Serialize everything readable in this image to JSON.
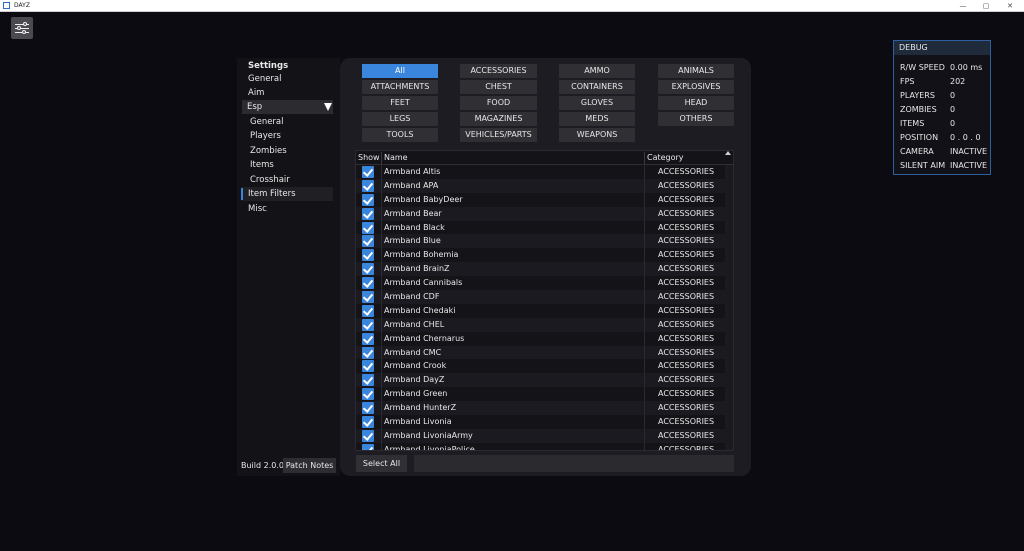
{
  "window": {
    "title": "DAYZ",
    "min": "—",
    "max": "▢",
    "close": "✕"
  },
  "sidebar": {
    "heading": "Settings",
    "items": [
      {
        "label": "General"
      },
      {
        "label": "Aim"
      },
      {
        "label": "Esp"
      },
      {
        "label": "General"
      },
      {
        "label": "Players"
      },
      {
        "label": "Zombies"
      },
      {
        "label": "Items"
      },
      {
        "label": "Crosshair"
      },
      {
        "label": "Item Filters"
      },
      {
        "label": "Misc"
      }
    ],
    "build": "Build 2.0.0",
    "patch_notes": "Patch Notes"
  },
  "filters": [
    {
      "label": "All",
      "active": true
    },
    {
      "label": "ACCESSORIES"
    },
    {
      "label": "AMMO"
    },
    {
      "label": "ANIMALS"
    },
    {
      "label": "ATTACHMENTS"
    },
    {
      "label": "CHEST"
    },
    {
      "label": "CONTAINERS"
    },
    {
      "label": "EXPLOSIVES"
    },
    {
      "label": "FEET"
    },
    {
      "label": "FOOD"
    },
    {
      "label": "GLOVES"
    },
    {
      "label": "HEAD"
    },
    {
      "label": "LEGS"
    },
    {
      "label": "MAGAZINES"
    },
    {
      "label": "MEDS"
    },
    {
      "label": "OTHERS"
    },
    {
      "label": "TOOLS"
    },
    {
      "label": "VEHICLES/PARTS"
    },
    {
      "label": "WEAPONS"
    }
  ],
  "table": {
    "headers": {
      "show": "Show",
      "name": "Name",
      "category": "Category"
    },
    "rows": [
      {
        "name": "Armband Altis",
        "category": "ACCESSORIES",
        "checked": true
      },
      {
        "name": "Armband APA",
        "category": "ACCESSORIES",
        "checked": true
      },
      {
        "name": "Armband BabyDeer",
        "category": "ACCESSORIES",
        "checked": true
      },
      {
        "name": "Armband Bear",
        "category": "ACCESSORIES",
        "checked": true
      },
      {
        "name": "Armband Black",
        "category": "ACCESSORIES",
        "checked": true
      },
      {
        "name": "Armband Blue",
        "category": "ACCESSORIES",
        "checked": true
      },
      {
        "name": "Armband Bohemia",
        "category": "ACCESSORIES",
        "checked": true
      },
      {
        "name": "Armband BrainZ",
        "category": "ACCESSORIES",
        "checked": true
      },
      {
        "name": "Armband Cannibals",
        "category": "ACCESSORIES",
        "checked": true
      },
      {
        "name": "Armband CDF",
        "category": "ACCESSORIES",
        "checked": true
      },
      {
        "name": "Armband Chedaki",
        "category": "ACCESSORIES",
        "checked": true
      },
      {
        "name": "Armband CHEL",
        "category": "ACCESSORIES",
        "checked": true
      },
      {
        "name": "Armband Chernarus",
        "category": "ACCESSORIES",
        "checked": true
      },
      {
        "name": "Armband CMC",
        "category": "ACCESSORIES",
        "checked": true
      },
      {
        "name": "Armband Crook",
        "category": "ACCESSORIES",
        "checked": true
      },
      {
        "name": "Armband DayZ",
        "category": "ACCESSORIES",
        "checked": true
      },
      {
        "name": "Armband Green",
        "category": "ACCESSORIES",
        "checked": true
      },
      {
        "name": "Armband HunterZ",
        "category": "ACCESSORIES",
        "checked": true
      },
      {
        "name": "Armband Livonia",
        "category": "ACCESSORIES",
        "checked": true
      },
      {
        "name": "Armband LivoniaArmy",
        "category": "ACCESSORIES",
        "checked": true
      },
      {
        "name": "Armband LivoniaPolice",
        "category": "ACCESSORIES",
        "checked": true
      }
    ]
  },
  "footer": {
    "select_all": "Select All"
  },
  "debug": {
    "title": "DEBUG",
    "rows": [
      {
        "label": "R/W SPEED",
        "value": "0.00 ms"
      },
      {
        "label": "FPS",
        "value": "202"
      },
      {
        "label": "PLAYERS",
        "value": "0"
      },
      {
        "label": "ZOMBIES",
        "value": "0"
      },
      {
        "label": "ITEMS",
        "value": "0"
      },
      {
        "label": "POSITION",
        "value": "0 . 0 . 0"
      },
      {
        "label": "CAMERA",
        "value": "INACTIVE"
      },
      {
        "label": "SILENT AIM",
        "value": "INACTIVE"
      }
    ]
  },
  "colors": {
    "accent": "#3b86dd",
    "background": "#0c0b12",
    "panel": "#1d1c22"
  }
}
